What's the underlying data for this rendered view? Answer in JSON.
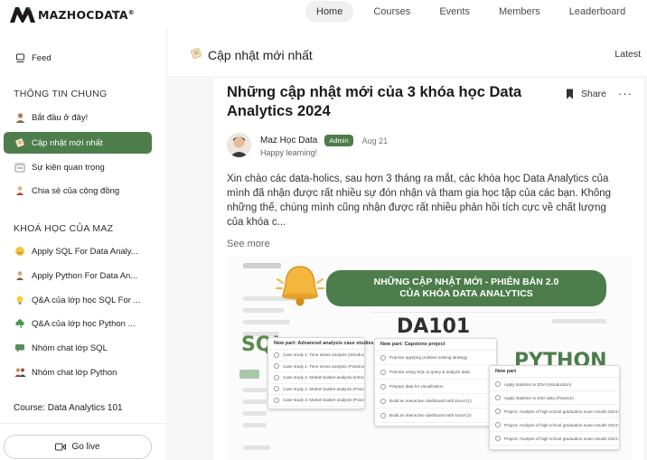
{
  "brand": {
    "name": "MAZHOCDATA",
    "reg": "®"
  },
  "nav": {
    "items": [
      {
        "label": "Home",
        "active": true
      },
      {
        "label": "Courses",
        "active": false
      },
      {
        "label": "Events",
        "active": false
      },
      {
        "label": "Members",
        "active": false
      },
      {
        "label": "Leaderboard",
        "active": false
      }
    ]
  },
  "sidebar": {
    "feed": "Feed",
    "section1": "THÔNG TIN CHUNG",
    "items1": [
      {
        "label": "Bắt đầu ở đây!",
        "icon": "person-icon"
      },
      {
        "label": "Cập nhật mới nhất",
        "icon": "scroll-icon",
        "active": true
      },
      {
        "label": "Sự kiện quan trọng",
        "icon": "calendar-icon"
      },
      {
        "label": "Chia sẻ của cộng đồng",
        "icon": "person-sharing-icon"
      }
    ],
    "section2": "KHOÁ HỌC CỦA MAZ",
    "items2": [
      {
        "label": "Apply SQL For Data Analy...",
        "icon": "smile-face-icon"
      },
      {
        "label": "Apply Python For Data An...",
        "icon": "person-icon"
      },
      {
        "label": "Q&A của lớp học SQL For ...",
        "icon": "lightbulb-icon"
      },
      {
        "label": "Q&A của lớp học Python ...",
        "icon": "clover-icon"
      },
      {
        "label": "Nhóm chat lớp SQL",
        "icon": "chat-icon"
      },
      {
        "label": "Nhóm chat lớp Python",
        "icon": "people-icon"
      }
    ],
    "course": "Course: Data Analytics 101",
    "golive": "Go live"
  },
  "main": {
    "title": "Cập nhật mới nhất",
    "sort": "Latest"
  },
  "post": {
    "title": "Những cập nhật mới của 3 khóa học Data Analytics 2024",
    "share": "Share",
    "author": "Maz Học Data",
    "badge": "Admin",
    "date": "Aug 21",
    "headline": "Happy learning!",
    "body": "Xin chào các data-holics, sau hơn 3 tháng ra mắt, các khóa học Data Analytics của mình đã nhận được rất nhiều sự đón nhận và tham gia học tập của các bạn. Không những thế, chúng mình cũng nhận được rất nhiều phản hồi tích cực về chất lượng của khóa c...",
    "see_more": "See more"
  },
  "banner": {
    "line1": "NHỮNG CẬP NHẬT MỚI - PHIÊN BẢN 2.0",
    "line2": "CỦA KHÓA DATA ANALYTICS",
    "word_sql": "SQL",
    "word_da": "DA101",
    "word_py": "PYTHON",
    "colors": {
      "green": "#4c7d4b",
      "sql": "#5a8a4d",
      "da": "#2f2f2f",
      "python": "#4c7d4b"
    },
    "card_sql": {
      "head": "New part: Advanced analysis case studies",
      "rows": [
        "Case study 1: Time series analysis (Introduction)",
        "Case study 1: Time series analysis (Practice)",
        "Case study 2: Market basket analysis (Introduction)",
        "Case study 2: Market basket analysis (Practice 1)",
        "Case study 3: Market basket analysis (Practice 2)"
      ]
    },
    "card_da": {
      "head": "New part: Capstone project",
      "rows": [
        "Practice applying problem solving strategy",
        "Practice using SQL to query & analyze data",
        "Prepare data for visualization",
        "Build an interactive dashboard with Excel (1)",
        "Build an interactive dashboard with Excel (2)"
      ]
    },
    "card_py": {
      "head": "New part",
      "rows": [
        "Apply statistics in EDA (Introduction)",
        "Apply statistics in EDA data (Practice)",
        "Project: Analysis of high school graduation exam results 2024 (1)",
        "Project: Analysis of high school graduation exam results 2024 (2)",
        "Project: Analysis of high school graduation exam results 2024 (3)"
      ]
    }
  }
}
